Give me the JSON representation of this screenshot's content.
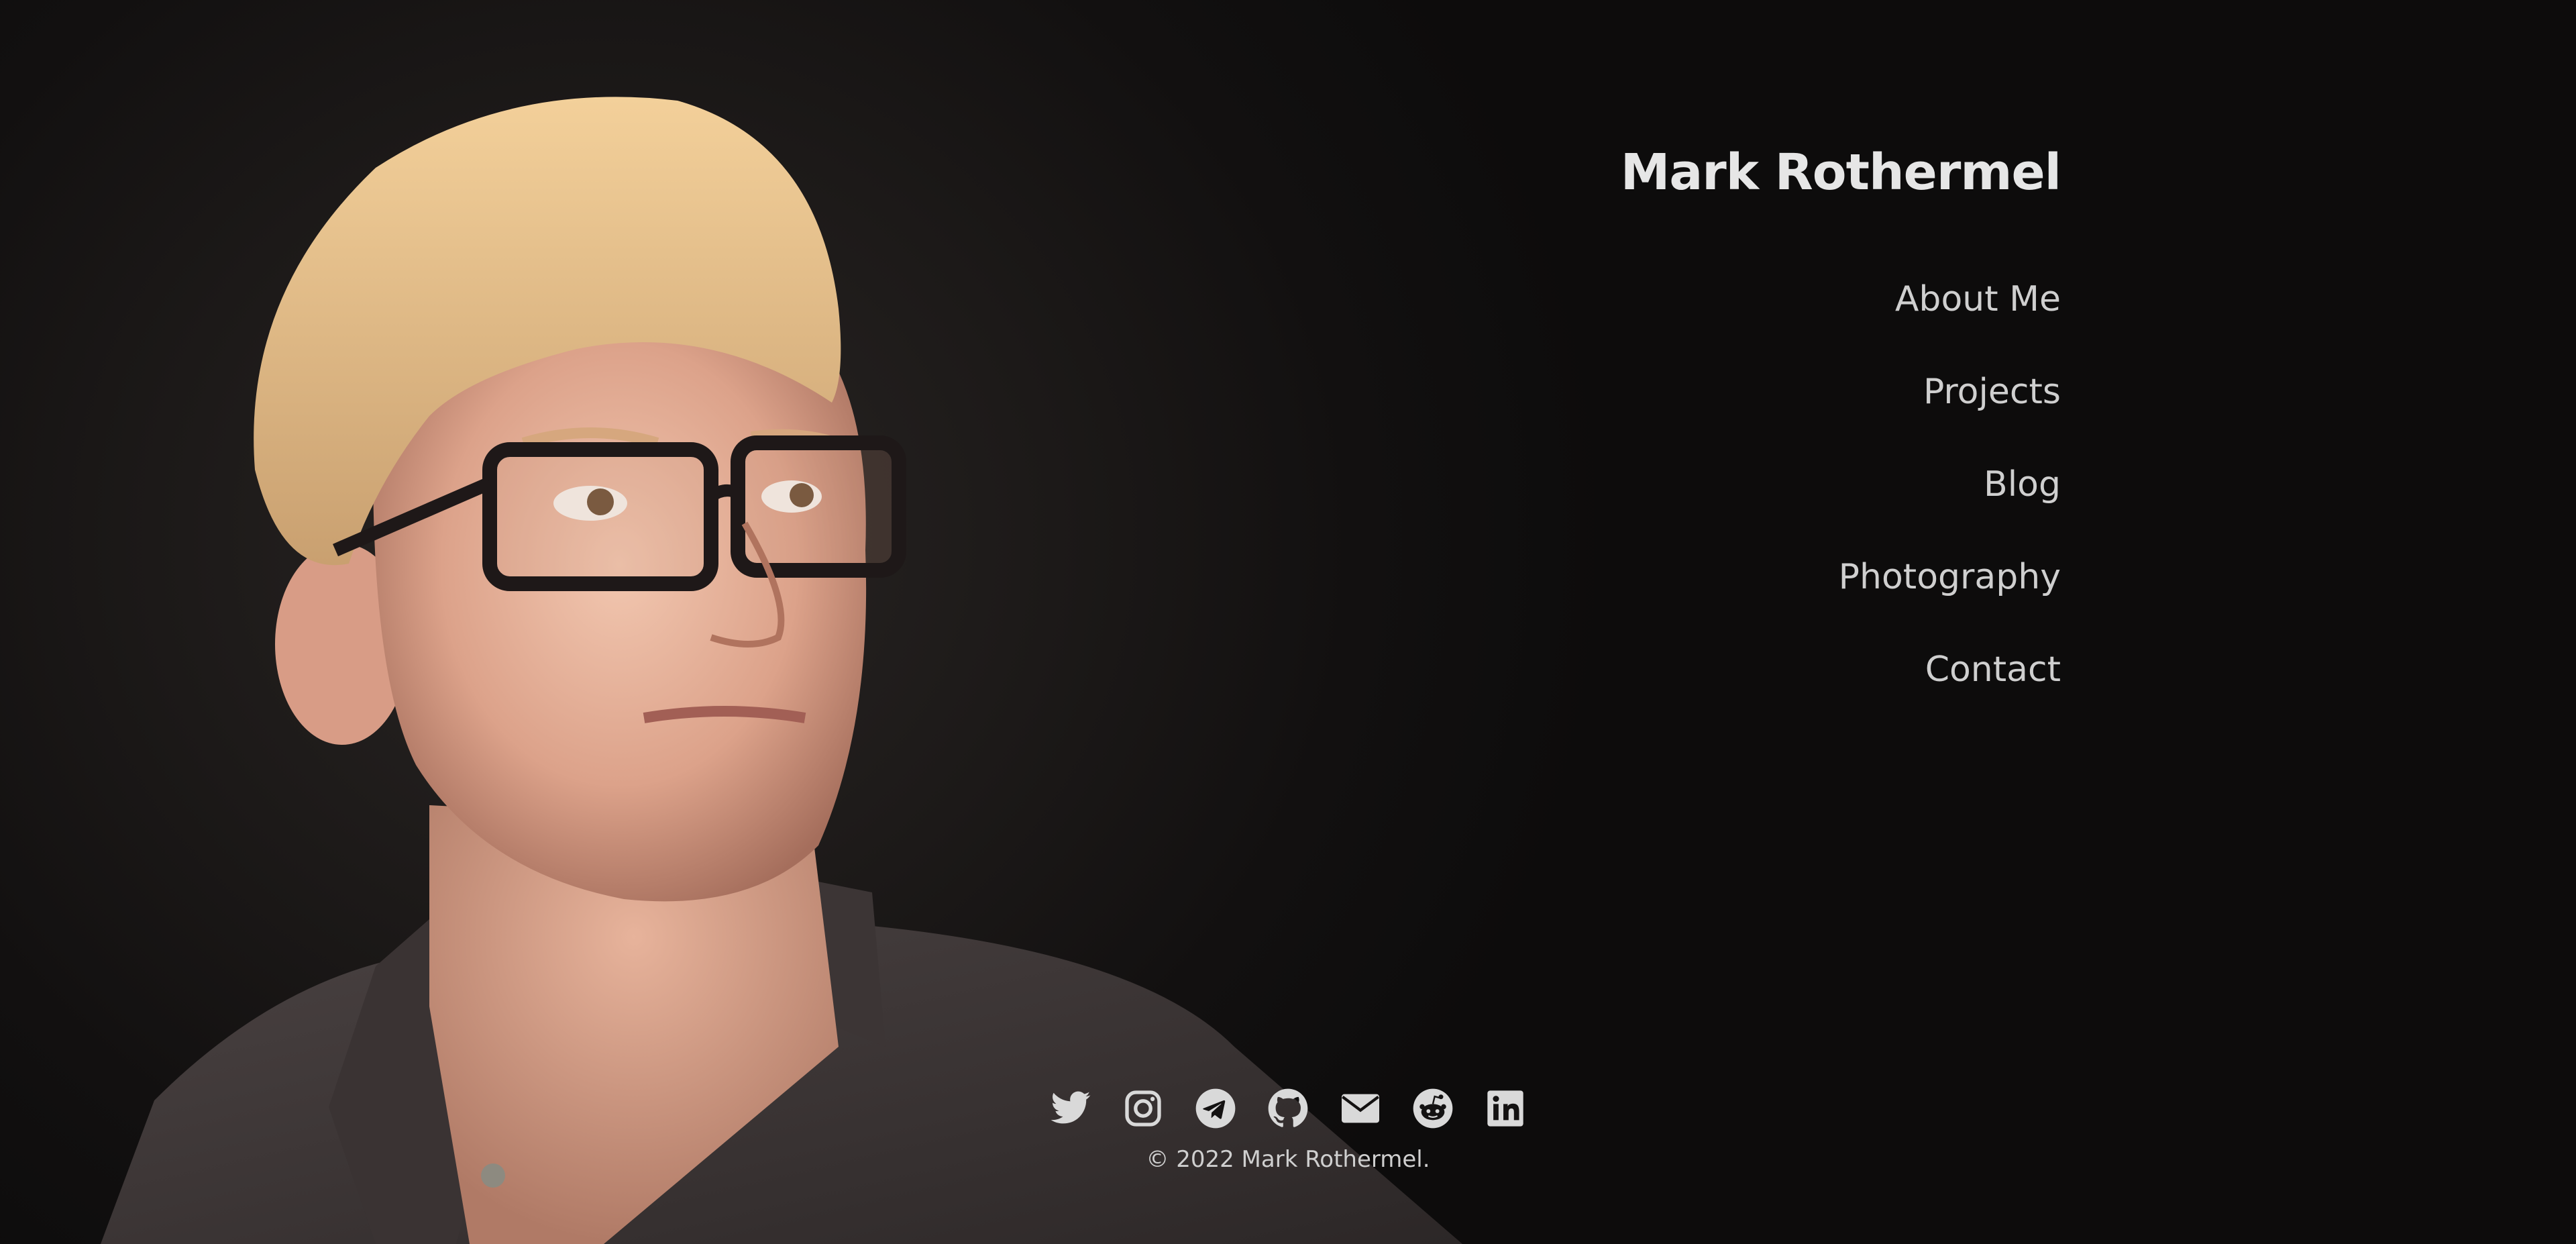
{
  "site": {
    "title": "Mark Rothermel"
  },
  "nav": [
    {
      "label": "About Me"
    },
    {
      "label": "Projects"
    },
    {
      "label": "Blog"
    },
    {
      "label": "Photography"
    },
    {
      "label": "Contact"
    }
  ],
  "social": [
    {
      "icon": "twitter-icon"
    },
    {
      "icon": "instagram-icon"
    },
    {
      "icon": "telegram-icon"
    },
    {
      "icon": "github-icon"
    },
    {
      "icon": "email-icon"
    },
    {
      "icon": "reddit-icon"
    },
    {
      "icon": "linkedin-icon"
    }
  ],
  "footer": {
    "copyright": "© 2022 Mark Rothermel."
  },
  "colors": {
    "background": "#0d0c0c",
    "text": "#e6e6e6",
    "icon": "#d9d9d9"
  }
}
